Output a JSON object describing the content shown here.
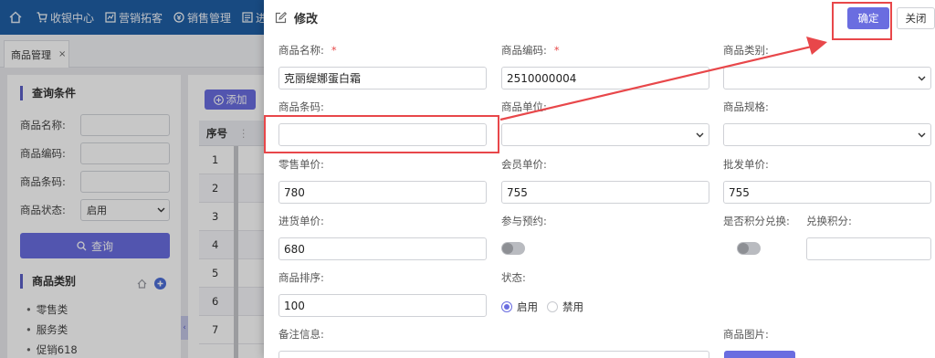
{
  "topnav": {
    "items": [
      {
        "label": "收银中心",
        "icon": "cart-icon"
      },
      {
        "label": "营销拓客",
        "icon": "marketing-icon"
      },
      {
        "label": "销售管理",
        "icon": "sales-icon"
      },
      {
        "label": "进",
        "icon": "report-icon"
      }
    ]
  },
  "tabs": [
    {
      "label": "商品管理",
      "close": "×"
    }
  ],
  "query": {
    "title": "查询条件",
    "fields": [
      {
        "label": "商品名称:",
        "value": ""
      },
      {
        "label": "商品编码:",
        "value": ""
      },
      {
        "label": "商品条码:",
        "value": ""
      }
    ],
    "status_label": "商品状态:",
    "status_value": "启用",
    "button": "查询"
  },
  "category": {
    "title": "商品类别",
    "items": [
      "零售类",
      "服务类",
      "促销618"
    ]
  },
  "grid": {
    "add_label": "添加",
    "col_seq": "序号",
    "rows": [
      "1",
      "2",
      "3",
      "4",
      "5",
      "6",
      "7"
    ]
  },
  "modal": {
    "title": "修改",
    "ok": "确定",
    "close": "关闭",
    "fields": {
      "name_label": "商品名称:",
      "name_value": "克丽缇娜蛋白霜",
      "code_label": "商品编码:",
      "code_value": "2510000004",
      "type_label": "商品类别:",
      "barcode_label": "商品条码:",
      "barcode_value": "",
      "unit_label": "商品单位:",
      "spec_label": "商品规格:",
      "retail_label": "零售单价:",
      "retail_value": "780",
      "member_label": "会员单价:",
      "member_value": "755",
      "wholesale_label": "批发单价:",
      "wholesale_value": "755",
      "purchase_label": "进货单价:",
      "purchase_value": "680",
      "reserve_label": "参与预约:",
      "reserve_on": false,
      "points_label": "是否积分兑换:",
      "points_on": false,
      "exchange_label": "兑换积分:",
      "exchange_value": "",
      "sort_label": "商品排序:",
      "sort_value": "100",
      "status_label": "状态:",
      "status_enabled": "启用",
      "status_disabled": "禁用",
      "status_selected": "启用",
      "remark_label": "备注信息:",
      "image_label": "商品图片:"
    }
  },
  "colors": {
    "accent": "#6a6de0",
    "nav": "#1f5fa6",
    "required": "#e64a4a",
    "annotation": "#e8474a"
  }
}
